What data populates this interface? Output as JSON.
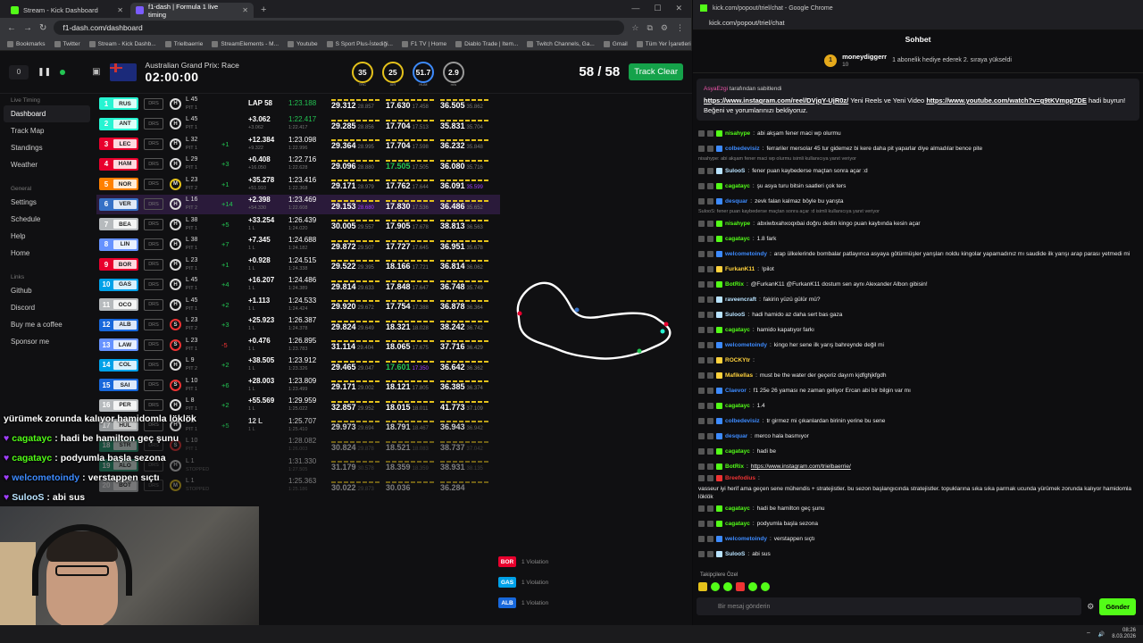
{
  "left_browser": {
    "tabs": [
      {
        "label": "Stream - Kick Dashboard",
        "active": false,
        "color": "#53fc18"
      },
      {
        "label": "f1-dash | Formula 1 live timing",
        "active": true,
        "color": "#7b5cff"
      }
    ],
    "url": "f1-dash.com/dashboard",
    "bookmarks": [
      "Bookmarks",
      "Twitter",
      "Stream - Kick Dashb...",
      "Trielbaerrie",
      "StreamElements - M...",
      "Youtube",
      "S Sport Plus-İstediği...",
      "F1 TV | Home",
      "Diablo Trade | Item...",
      "Twitch Channels, Ga...",
      "Gmail",
      "Tüm Yer İşaretleri"
    ]
  },
  "dashboard": {
    "race_name": "Australian Grand Prix: Race",
    "race_clock": "02:00:00",
    "rec_count": "0",
    "gauges": [
      {
        "value": "35",
        "label": "TRC",
        "color": "#e5c21b"
      },
      {
        "value": "25",
        "label": "AIR",
        "color": "#e5c21b"
      },
      {
        "value": "51.7",
        "label": "HUM",
        "color": "#3d8bff"
      },
      {
        "value": "2.9",
        "label": "m/s",
        "color": "#999"
      }
    ],
    "laps": "58 / 58",
    "track_clear": "Track Clear",
    "sidebar": {
      "live_timing_header": "Live Timing",
      "live_items": [
        "Dashboard",
        "Track Map",
        "Standings",
        "Weather"
      ],
      "general_header": "General",
      "general_items": [
        "Settings",
        "Schedule",
        "Help",
        "Home"
      ],
      "links_header": "Links",
      "link_items": [
        "Github",
        "Discord",
        "Buy me a coffee",
        "Sponsor me"
      ]
    },
    "rows": [
      {
        "n": "1",
        "code": "RUS",
        "color": "#27f4d2",
        "tyre": "H",
        "lap": "L 45",
        "pit": "PIT 1",
        "pg": "",
        "gap": "LAP 58",
        "int": "",
        "lt": "1:23.188",
        "ltp": "",
        "s1": "29.312",
        "s1p": "28.857",
        "s2": "17.630",
        "s2p": "17.458",
        "s3": "36.505",
        "s3p": "35.862",
        "hl": false
      },
      {
        "n": "2",
        "code": "ANT",
        "color": "#27f4d2",
        "tyre": "H",
        "lap": "L 45",
        "pit": "PIT 1",
        "pg": "",
        "gap": "+3.062",
        "int": "+3.062",
        "lt": "1:22.417",
        "ltp": "1:22.417",
        "s1": "29.285",
        "s1p": "28.856",
        "s2": "17.704",
        "s2p": "17.513",
        "s3": "35.831",
        "s3p": "35.704",
        "hl": false
      },
      {
        "n": "3",
        "code": "LEC",
        "color": "#e8002d",
        "tyre": "H",
        "lap": "L 32",
        "pit": "PIT 1",
        "pg": "+1",
        "gap": "+12.384",
        "int": "+9.322",
        "lt": "1:23.098",
        "ltp": "1:22.996",
        "s1": "29.364",
        "s1p": "28.995",
        "s2": "17.704",
        "s2p": "17.598",
        "s3": "36.232",
        "s3p": "35.848",
        "hl": false
      },
      {
        "n": "4",
        "code": "HAM",
        "color": "#e8002d",
        "tyre": "H",
        "lap": "L 29",
        "pit": "PIT 1",
        "pg": "+3",
        "gap": "+0.408",
        "int": "+16.050",
        "lt": "1:22.716",
        "ltp": "1:22.628",
        "s1": "29.096",
        "s1p": "28.880",
        "s2": "17.505",
        "s2p": "17.505",
        "s3": "36.080",
        "s3p": "35.716",
        "hl": false
      },
      {
        "n": "5",
        "code": "NOR",
        "color": "#ff8000",
        "tyre": "M",
        "lap": "L 23",
        "pit": "PIT 2",
        "pg": "+1",
        "gap": "+35.278",
        "int": "+51.910",
        "lt": "1:23.416",
        "ltp": "1:22.368",
        "s1": "29.171",
        "s1p": "28.979",
        "s2": "17.762",
        "s2p": "17.644",
        "s3": "36.091",
        "s3p": "35.599",
        "hl": false
      },
      {
        "n": "6",
        "code": "VER",
        "color": "#3671c6",
        "tyre": "H",
        "lap": "L 16",
        "pit": "PIT 2",
        "pg": "+14",
        "gap": "+2.398",
        "int": "+54.330",
        "lt": "1:23.469",
        "ltp": "1:22.608",
        "s1": "29.153",
        "s1p": "28.680",
        "s2": "17.830",
        "s2p": "17.536",
        "s3": "36.486",
        "s3p": "35.652",
        "hl": true
      },
      {
        "n": "7",
        "code": "BEA",
        "color": "#b6babd",
        "tyre": "H",
        "lap": "L 38",
        "pit": "PIT 1",
        "pg": "+5",
        "gap": "+33.254",
        "int": "1 L",
        "lt": "1:26.439",
        "ltp": "1:24.020",
        "s1": "30.005",
        "s1p": "29.557",
        "s2": "17.905",
        "s2p": "17.678",
        "s3": "38.813",
        "s3p": "36.563",
        "hl": false
      },
      {
        "n": "8",
        "code": "LIN",
        "color": "#6692ff",
        "tyre": "H",
        "lap": "L 38",
        "pit": "PIT 1",
        "pg": "+7",
        "gap": "+7.345",
        "int": "1 L",
        "lt": "1:24.688",
        "ltp": "1:24.182",
        "s1": "29.872",
        "s1p": "29.507",
        "s2": "17.727",
        "s2p": "17.645",
        "s3": "36.951",
        "s3p": "35.678",
        "hl": false
      },
      {
        "n": "9",
        "code": "BOR",
        "color": "#e8002d",
        "tyre": "H",
        "lap": "L 23",
        "pit": "PIT 1",
        "pg": "+1",
        "gap": "+0.928",
        "int": "1 L",
        "lt": "1:24.515",
        "ltp": "1:24.338",
        "s1": "29.522",
        "s1p": "29.395",
        "s2": "18.166",
        "s2p": "17.721",
        "s3": "36.814",
        "s3p": "36.062",
        "hl": false
      },
      {
        "n": "10",
        "code": "GAS",
        "color": "#00a1e8",
        "tyre": "H",
        "lap": "L 45",
        "pit": "PIT 1",
        "pg": "+4",
        "gap": "+16.207",
        "int": "1 L",
        "lt": "1:24.486",
        "ltp": "1:24.389",
        "s1": "29.814",
        "s1p": "29.633",
        "s2": "17.848",
        "s2p": "17.647",
        "s3": "36.748",
        "s3p": "35.749",
        "hl": false
      },
      {
        "n": "11",
        "code": "OCO",
        "color": "#b6babd",
        "tyre": "H",
        "lap": "L 45",
        "pit": "PIT 1",
        "pg": "+2",
        "gap": "+1.113",
        "int": "1 L",
        "lt": "1:24.533",
        "ltp": "1:24.424",
        "s1": "29.920",
        "s1p": "29.672",
        "s2": "17.754",
        "s2p": "17.388",
        "s3": "36.878",
        "s3p": "36.364",
        "hl": false
      },
      {
        "n": "12",
        "code": "ALB",
        "color": "#1868db",
        "tyre": "S",
        "lap": "L 23",
        "pit": "PIT 2",
        "pg": "+3",
        "gap": "+25.923",
        "int": "1 L",
        "lt": "1:26.387",
        "ltp": "1:24.378",
        "s1": "29.824",
        "s1p": "29.649",
        "s2": "18.321",
        "s2p": "18.028",
        "s3": "38.242",
        "s3p": "36.742",
        "hl": false
      },
      {
        "n": "13",
        "code": "LAW",
        "color": "#6692ff",
        "tyre": "S",
        "lap": "L 23",
        "pit": "PIT 1",
        "pg": "-5",
        "gap": "+0.476",
        "int": "1 L",
        "lt": "1:26.895",
        "ltp": "1:23.783",
        "s1": "31.114",
        "s1p": "29.404",
        "s2": "18.065",
        "s2p": "17.675",
        "s3": "37.716",
        "s3p": "36.429",
        "hl": false
      },
      {
        "n": "14",
        "code": "COL",
        "color": "#00a1e8",
        "tyre": "H",
        "lap": "L 9",
        "pit": "PIT 2",
        "pg": "+2",
        "gap": "+38.505",
        "int": "1 L",
        "lt": "1:23.912",
        "ltp": "1:23.326",
        "s1": "29.465",
        "s1p": "29.047",
        "s2": "17.601",
        "s2p": "17.350",
        "s3": "36.642",
        "s3p": "36.362",
        "hl": false
      },
      {
        "n": "15",
        "code": "SAI",
        "color": "#1868db",
        "tyre": "S",
        "lap": "L 10",
        "pit": "PIT 1",
        "pg": "+6",
        "gap": "+28.003",
        "int": "1 L",
        "lt": "1:23.809",
        "ltp": "1:23.499",
        "s1": "29.171",
        "s1p": "29.002",
        "s2": "18.121",
        "s2p": "17.805",
        "s3": "36.385",
        "s3p": "36.374",
        "hl": false
      },
      {
        "n": "16",
        "code": "PER",
        "color": "#b6babd",
        "tyre": "H",
        "lap": "L 8",
        "pit": "PIT 1",
        "pg": "+2",
        "gap": "+55.569",
        "int": "1 L",
        "lt": "1:29.959",
        "ltp": "1:25.022",
        "s1": "32.857",
        "s1p": "29.952",
        "s2": "18.015",
        "s2p": "18.011",
        "s3": "41.773",
        "s3p": "37.109",
        "hl": false
      },
      {
        "n": "17",
        "code": "HUL",
        "color": "#b6babd",
        "tyre": "H",
        "lap": "L 5",
        "pit": "PIT 1",
        "pg": "+5",
        "gap": "12 L",
        "int": "1 L",
        "lt": "1:25.707",
        "ltp": "1:25.410",
        "s1": "29.973",
        "s1p": "29.694",
        "s2": "18.791",
        "s2p": "18.467",
        "s3": "36.943",
        "s3p": "36.942",
        "hl": false
      },
      {
        "n": "18",
        "code": "STR",
        "color": "#229971",
        "tyre": "S",
        "lap": "L 10",
        "pit": "PIT 1",
        "pg": "",
        "gap": "",
        "int": "",
        "lt": "1:28.082",
        "ltp": "1:26.003",
        "s1": "30.824",
        "s1p": "29.878",
        "s2": "18.521",
        "s2p": "18.083",
        "s3": "38.737",
        "s3p": "37.042",
        "hl": false
      },
      {
        "n": "19",
        "code": "ALO",
        "color": "#229971",
        "tyre": "H",
        "lap": "L 1",
        "pit": "STOPPED",
        "pg": "",
        "gap": "",
        "int": "",
        "lt": "1:31.330",
        "ltp": "1:27.505",
        "s1": "31.179",
        "s1p": "30.578",
        "s2": "18.359",
        "s2p": "18.359",
        "s3": "38.931",
        "s3p": "38.135",
        "hl": false
      },
      {
        "n": "20",
        "code": "BOT",
        "color": "#b6babd",
        "tyre": "M",
        "lap": "L 1",
        "pit": "STOPPED",
        "pg": "",
        "gap": "",
        "int": "",
        "lt": "1:25.363",
        "ltp": "1:25.186",
        "s1": "30.022",
        "s1p": "29.873",
        "s2": "30.036",
        "s2p": "",
        "s3": "36.284",
        "s3p": "",
        "hl": false
      }
    ],
    "violations": [
      {
        "code": "BOR",
        "text": "1 Violation",
        "color": "#e8002d"
      },
      {
        "code": "GAS",
        "text": "1 Violation",
        "color": "#00a1e8"
      },
      {
        "code": "ALB",
        "text": "1 Violation",
        "color": "#1868db"
      }
    ]
  },
  "overlay_chat": [
    {
      "user": "",
      "text": "yürümek zorunda kalıyor hamidomla löklök",
      "color": "#fff"
    },
    {
      "user": "cagatayc",
      "text": "hadi be hamilton geç şunu",
      "color": "#53fc18"
    },
    {
      "user": "cagatayc",
      "text": "podyumla başla sezona",
      "color": "#53fc18"
    },
    {
      "user": "welcometoindy",
      "text": "verstappen sıçtı",
      "color": "#3d8bff"
    },
    {
      "user": "SulooS",
      "text": "abi sus",
      "color": "#b9e3ff"
    }
  ],
  "right_browser": {
    "title": "kick.com/popout/triel/chat - Google Chrome",
    "url": "kick.com/popout/triel/chat",
    "chat_title": "Sohbet",
    "gift": {
      "user": "moneydiggerr",
      "count": "10",
      "text": "1 abonelik hediye ederek 2. sıraya yükseldi"
    },
    "pinned": {
      "user": "AsyaEzgi",
      "by": "tarafından sabitlendi",
      "link1": "https://www.instagram.com/reel/DVjqY-UjR0z/",
      "mid": "Yeni Reels ve Yeni Video",
      "link2": "https://www.youtube.com/watch?v=g9tKVmpp7DE",
      "end": "hadi buyrun! Beğeni ve yorumlarınızı bekliyoruz."
    },
    "messages": [
      {
        "u": "nisahype",
        "c": "#53fc18",
        "t": "abi akşam fener maci wp olurmu"
      },
      {
        "u": "colbedevisiz",
        "c": "#3d8bff",
        "t": "ferrariler mersolar 45 tur gidemez bi kere daha pit yaparlar diye almadılar bence pite"
      },
      {
        "reply": "nisahype: abi akşam fener maci wp olurmu isimli kullanıcıya yanıt veriyor"
      },
      {
        "u": "SulooS",
        "c": "#b9e3ff",
        "t": "fener puan kaybederse maçtan sonra açar :d"
      },
      {
        "u": "cagatayc",
        "c": "#53fc18",
        "t": "şu asya turu bitsin saatleri çok ters"
      },
      {
        "u": "desquar",
        "c": "#3d8bff",
        "t": "zevk falan kalmaz böyle bu yarışta"
      },
      {
        "reply": "SulooS: fener puan kaybederse maçtan sonra açar :d isimli kullanıcıya yanıt veriyor"
      },
      {
        "u": "nisahype",
        "c": "#53fc18",
        "t": "abxiwbxahxoqxbai doğru dedin kingo puan kaybında kesin açar"
      },
      {
        "u": "cagatayc",
        "c": "#53fc18",
        "t": "1.8 fark"
      },
      {
        "u": "welcometoindy",
        "c": "#3d8bff",
        "t": "arap ülkelerinde bombalar patlayınca asyaya götürmüşler yarışları noldu kingolar yapamadınız mı saudide ilk yarışı arap parası yetmedi mi"
      },
      {
        "u": "FurkanK11",
        "c": "#ffd23d",
        "t": "!pilot"
      },
      {
        "u": "BotRix",
        "c": "#53fc18",
        "t": "@FurkanK11 @FurkanK11 dostum sen aynı Alexander Albon gibisin!"
      },
      {
        "u": "raveencraft",
        "c": "#b9e3ff",
        "t": "fakirin yüzü gülür mü?"
      },
      {
        "u": "SulooS",
        "c": "#b9e3ff",
        "t": "hadi hamido az daha sert bas gaza"
      },
      {
        "u": "cagatayc",
        "c": "#53fc18",
        "t": "hamido kapatıyor farkı"
      },
      {
        "u": "welcometoindy",
        "c": "#3d8bff",
        "t": "kingo her sene ilk yarış bahreynde değil mi"
      },
      {
        "u": "ROCKYtr",
        "c": "#ffd23d",
        "t": ""
      },
      {
        "u": "Mafikellas",
        "c": "#ffd23d",
        "t": "must be the water der geçeriz dayım kjdfghjkfgdh"
      },
      {
        "u": "Claevor",
        "c": "#3d8bff",
        "t": "f1 25e 26 yaması ne zaman geliyor Ercan abi bir bilgin var mı"
      },
      {
        "u": "cagatayc",
        "c": "#53fc18",
        "t": "1.4"
      },
      {
        "u": "colbedevisiz",
        "c": "#3d8bff",
        "t": "tr girmez mi çıkanlardan birinin yerine bu sene"
      },
      {
        "u": "desquar",
        "c": "#3d8bff",
        "t": "merco hala basmıyor"
      },
      {
        "u": "cagatayc",
        "c": "#53fc18",
        "t": "hadi be"
      },
      {
        "u": "BotRix",
        "c": "#53fc18",
        "t": "https://www.instagram.com/trielbaerrie/"
      },
      {
        "u": "Breefodius",
        "c": "#e33",
        "t": "vasseur iyi herif ama geçen sene mühendis + stratejistler. bu sezon başlangıcında stratejistler. topuklarına sıka sıka parmak ucunda yürümek zorunda kalıyor hamidomla löklök"
      },
      {
        "u": "cagatayc",
        "c": "#53fc18",
        "t": "hadi be hamilton geç şunu"
      },
      {
        "u": "cagatayc",
        "c": "#53fc18",
        "t": "podyumla başla sezona"
      },
      {
        "u": "welcometoindy",
        "c": "#3d8bff",
        "t": "verstappen sıçtı"
      },
      {
        "u": "SulooS",
        "c": "#b9e3ff",
        "t": "abi sus"
      }
    ],
    "followers_label": "Takipçilere Özel",
    "input_placeholder": "Bir mesaj gönderin",
    "send_label": "Gönder",
    "clock": "08:26",
    "date": "8.03.2026"
  }
}
